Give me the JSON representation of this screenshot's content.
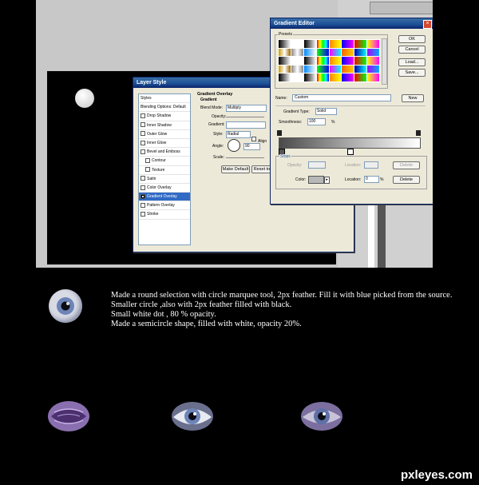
{
  "layer_style": {
    "title": "Layer Style",
    "items": [
      {
        "label": "Styles",
        "checked": false,
        "sel": false
      },
      {
        "label": "Blending Options: Default",
        "checked": false,
        "sel": false
      },
      {
        "label": "Drop Shadow",
        "checked": false,
        "sel": false
      },
      {
        "label": "Inner Shadow",
        "checked": false,
        "sel": false
      },
      {
        "label": "Outer Glow",
        "checked": false,
        "sel": false
      },
      {
        "label": "Inner Glow",
        "checked": false,
        "sel": false
      },
      {
        "label": "Bevel and Emboss",
        "checked": false,
        "sel": false
      },
      {
        "label": "Contour",
        "checked": false,
        "sel": false,
        "sub": true
      },
      {
        "label": "Texture",
        "checked": false,
        "sel": false,
        "sub": true
      },
      {
        "label": "Satin",
        "checked": false,
        "sel": false
      },
      {
        "label": "Color Overlay",
        "checked": false,
        "sel": false
      },
      {
        "label": "Gradient Overlay",
        "checked": true,
        "sel": true
      },
      {
        "label": "Pattern Overlay",
        "checked": false,
        "sel": false
      },
      {
        "label": "Stroke",
        "checked": false,
        "sel": false
      }
    ],
    "section_title": "Gradient Overlay",
    "group_title": "Gradient",
    "blend_mode_label": "Blend Mode:",
    "blend_mode_value": "Multiply",
    "opacity_label": "Opacity:",
    "gradient_label": "Gradient:",
    "style_label": "Style:",
    "style_value": "Radial",
    "align_label": "Align",
    "angle_label": "Angle:",
    "angle_value": "90",
    "scale_label": "Scale:",
    "make_default_label": "Make Default",
    "reset_default_label": "Reset to"
  },
  "gradient_editor": {
    "title": "Gradient Editor",
    "presets_label": "Presets",
    "ok_label": "OK",
    "cancel_label": "Cancel",
    "load_label": "Load...",
    "save_label": "Save...",
    "name_label": "Name:",
    "name_value": "Custom",
    "new_label": "New",
    "gradient_type_label": "Gradient Type:",
    "gradient_type_value": "Solid",
    "smoothness_label": "Smoothness:",
    "smoothness_value": "100",
    "percent": "%",
    "stops_label": "Stops",
    "opacity_label": "Opacity:",
    "location_label": "Location:",
    "delete_label": "Delete",
    "color_label": "Color:",
    "location_value": "0"
  },
  "caption": {
    "lines": [
      "Made a round selection with circle marquee tool, 2px feather. Fill it with blue picked from the source.  Smaller circle ,also with 2px feather filled with black.",
      "Small white dot , 80 % opacity.",
      "Made a semicircle shape, filled with white, opacity 20%."
    ]
  },
  "watermark": "pxleyes.com"
}
